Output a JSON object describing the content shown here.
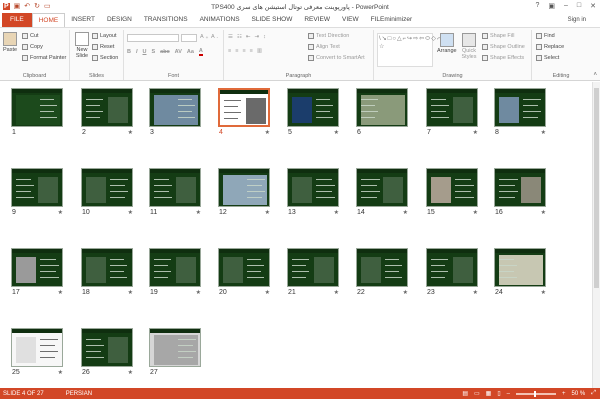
{
  "title_bar": {
    "title": "TPS400 پاورپوینت معرفی توتال استیشن های سری - PowerPoint",
    "qat_icons": [
      "save-icon",
      "undo-icon",
      "redo-icon",
      "slideshow-icon"
    ],
    "window_buttons": [
      "?",
      "▣",
      "–",
      "□",
      "✕"
    ]
  },
  "tabs": {
    "file": "FILE",
    "items": [
      "HOME",
      "INSERT",
      "DESIGN",
      "TRANSITIONS",
      "ANIMATIONS",
      "SLIDE SHOW",
      "REVIEW",
      "VIEW",
      "FILEminimizer"
    ],
    "active": "HOME",
    "signin": "Sign in"
  },
  "ribbon": {
    "clipboard": {
      "label": "Clipboard",
      "paste": "Paste",
      "cut": "Cut",
      "copy": "Copy",
      "format_painter": "Format Painter"
    },
    "slides": {
      "label": "Slides",
      "new_slide": "New Slide",
      "layout": "Layout",
      "reset": "Reset",
      "section": "Section"
    },
    "font": {
      "label": "Font",
      "font_name": "",
      "font_size": ""
    },
    "paragraph": {
      "label": "Paragraph",
      "text_direction": "Text Direction",
      "align_text": "Align Text",
      "convert_smartart": "Convert to SmartArt"
    },
    "drawing": {
      "label": "Drawing",
      "arrange": "Arrange",
      "quick_styles": "Quick Styles",
      "shape_fill": "Shape Fill",
      "shape_outline": "Shape Outline",
      "shape_effects": "Shape Effects"
    },
    "editing": {
      "label": "Editing",
      "find": "Find",
      "replace": "Replace",
      "select": "Select"
    }
  },
  "slides": [
    {
      "num": "1",
      "star": ""
    },
    {
      "num": "2",
      "star": "★"
    },
    {
      "num": "3",
      "star": ""
    },
    {
      "num": "4",
      "star": "★",
      "selected": true
    },
    {
      "num": "5",
      "star": "★"
    },
    {
      "num": "6",
      "star": ""
    },
    {
      "num": "7",
      "star": "★"
    },
    {
      "num": "8",
      "star": "★"
    },
    {
      "num": "9",
      "star": "★"
    },
    {
      "num": "10",
      "star": "★"
    },
    {
      "num": "11",
      "star": "★"
    },
    {
      "num": "12",
      "star": "★"
    },
    {
      "num": "13",
      "star": "★"
    },
    {
      "num": "14",
      "star": "★"
    },
    {
      "num": "15",
      "star": "★"
    },
    {
      "num": "16",
      "star": "★"
    },
    {
      "num": "17",
      "star": "★"
    },
    {
      "num": "18",
      "star": "★"
    },
    {
      "num": "19",
      "star": "★"
    },
    {
      "num": "20",
      "star": "★"
    },
    {
      "num": "21",
      "star": "★"
    },
    {
      "num": "22",
      "star": "★"
    },
    {
      "num": "23",
      "star": "★"
    },
    {
      "num": "24",
      "star": "★"
    },
    {
      "num": "25",
      "star": "★"
    },
    {
      "num": "26",
      "star": "★"
    },
    {
      "num": "27",
      "star": ""
    }
  ],
  "status": {
    "slide_of": "SLIDE 4 OF 27",
    "language": "PERSIAN",
    "zoom": "50 %"
  }
}
